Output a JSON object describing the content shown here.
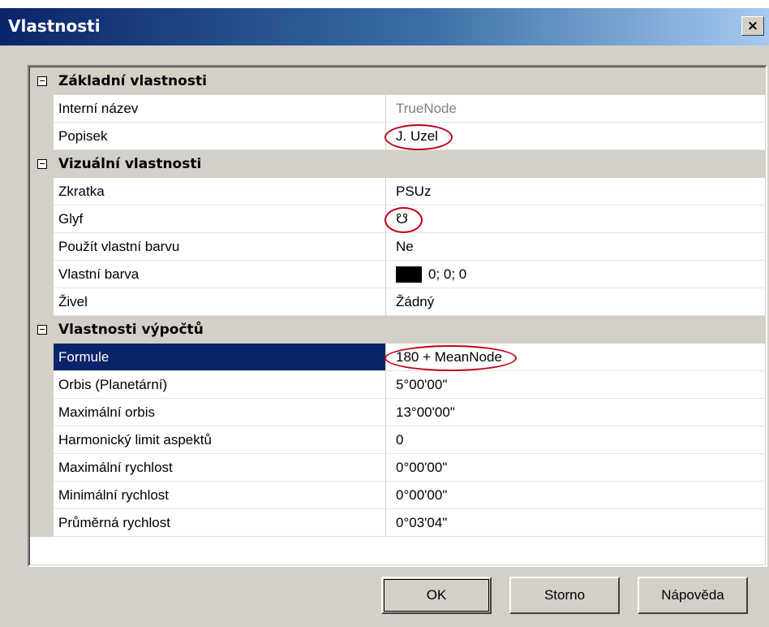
{
  "window": {
    "title": "Vlastnosti",
    "close_glyph": "×"
  },
  "grid": {
    "categories": [
      {
        "label": "Základní vlastnosti",
        "rows": [
          {
            "name": "Interní název",
            "value": "TrueNode",
            "disabled": true
          },
          {
            "name": "Popisek",
            "value": "J. Uzel",
            "circled": true
          }
        ]
      },
      {
        "label": "Vizuální vlastnosti",
        "rows": [
          {
            "name": "Zkratka",
            "value": "PSUz"
          },
          {
            "name": "Glyf",
            "value": "☋",
            "circled": true
          },
          {
            "name": "Použít vlastní barvu",
            "value": "Ne"
          },
          {
            "name": "Vlastní barva",
            "value": "0; 0; 0",
            "swatch_color": "#000000"
          },
          {
            "name": "Živel",
            "value": "Žádný"
          }
        ]
      },
      {
        "label": "Vlastnosti výpočtů",
        "rows": [
          {
            "name": "Formule",
            "value": "180 + MeanNode",
            "selected": true,
            "circled": true
          },
          {
            "name": "Orbis (Planetární)",
            "value": "5°00'00\""
          },
          {
            "name": "Maximální orbis",
            "value": "13°00'00\""
          },
          {
            "name": "Harmonický limit aspektů",
            "value": "0"
          },
          {
            "name": "Maximální rychlost",
            "value": "0°00'00\""
          },
          {
            "name": "Minimální rychlost",
            "value": "0°00'00\""
          },
          {
            "name": "Průměrná rychlost",
            "value": "0°03'04\""
          }
        ]
      }
    ]
  },
  "buttons": {
    "ok": "OK",
    "cancel": "Storno",
    "help": "Nápověda"
  },
  "colors": {
    "selection": "#0a246a",
    "annotation_circle": "#c0001a",
    "dialog_face": "#d4d0c8"
  }
}
